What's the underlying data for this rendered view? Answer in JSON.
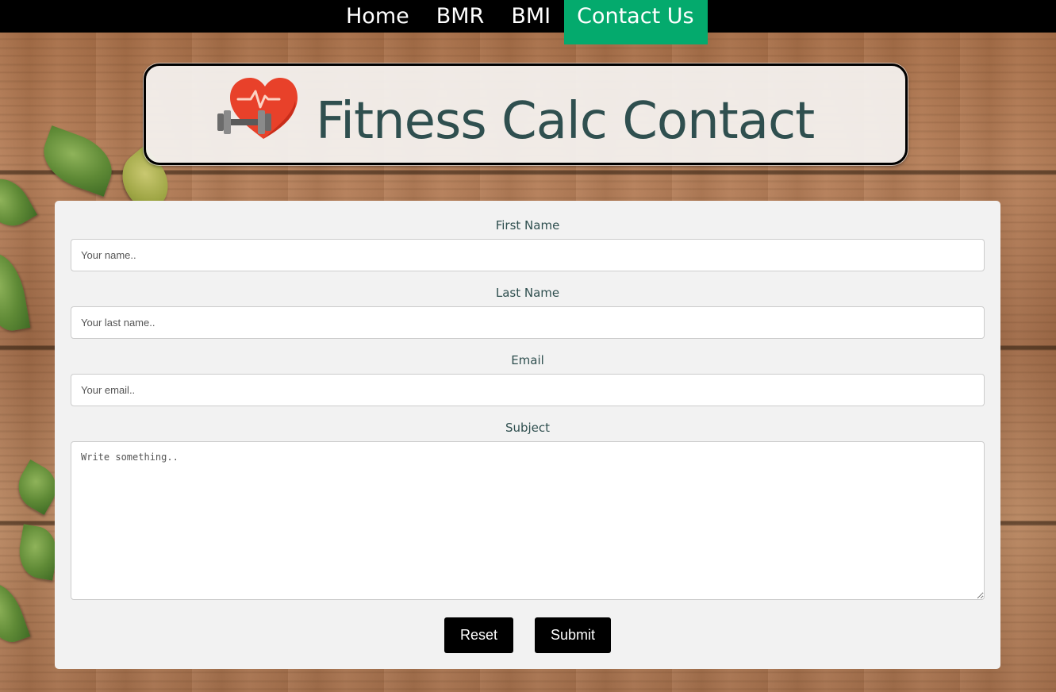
{
  "nav": {
    "items": [
      {
        "label": "Home",
        "active": false
      },
      {
        "label": "BMR",
        "active": false
      },
      {
        "label": "BMI",
        "active": false
      },
      {
        "label": "Contact Us",
        "active": true
      }
    ],
    "active_color": "#04aa6d"
  },
  "header": {
    "title": "Fitness Calc Contact",
    "logo_icon": "heart-dumbbell-icon"
  },
  "form": {
    "first_name": {
      "label": "First Name",
      "placeholder": "Your name.."
    },
    "last_name": {
      "label": "Last Name",
      "placeholder": "Your last name.."
    },
    "email": {
      "label": "Email",
      "placeholder": "Your email.."
    },
    "subject": {
      "label": "Subject",
      "placeholder": "Write something.."
    },
    "reset_label": "Reset",
    "submit_label": "Submit"
  }
}
